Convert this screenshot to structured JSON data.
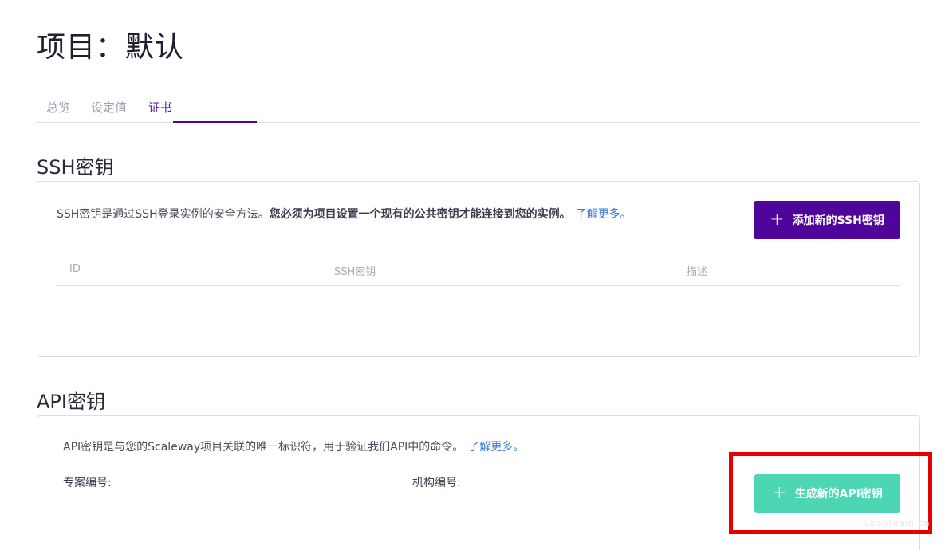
{
  "page": {
    "title": "项目：默认"
  },
  "tabs": [
    {
      "label": "总览",
      "active": false
    },
    {
      "label": "设定值",
      "active": false
    },
    {
      "label": "证书",
      "active": true
    }
  ],
  "ssh": {
    "section_title": "SSH密钥",
    "description": "SSH密钥是通过SSH登录实例的安全方法。",
    "description_bold": "您必须为项目设置一个现有的公共密钥才能连接到您的实例。",
    "learn_more": "了解更多。",
    "add_button": "添加新的SSH密钥",
    "table": {
      "columns": [
        "ID",
        "SSH密钥",
        "描述"
      ],
      "rows": []
    }
  },
  "api": {
    "section_title": "API密钥",
    "description": "API密钥是与您的Scaleway项目关联的唯一标识符，用于验证我们API中的命令。",
    "learn_more": "了解更多。",
    "project_id_label": "专案编号:",
    "org_id_label": "机构编号:",
    "generate_button": "生成新的API密钥"
  },
  "watermark": "Leapteam.cn",
  "colors": {
    "primary": "#4f0599",
    "teal": "#4dd6b3",
    "link": "#3a7bd5",
    "highlight": "#e60000"
  }
}
